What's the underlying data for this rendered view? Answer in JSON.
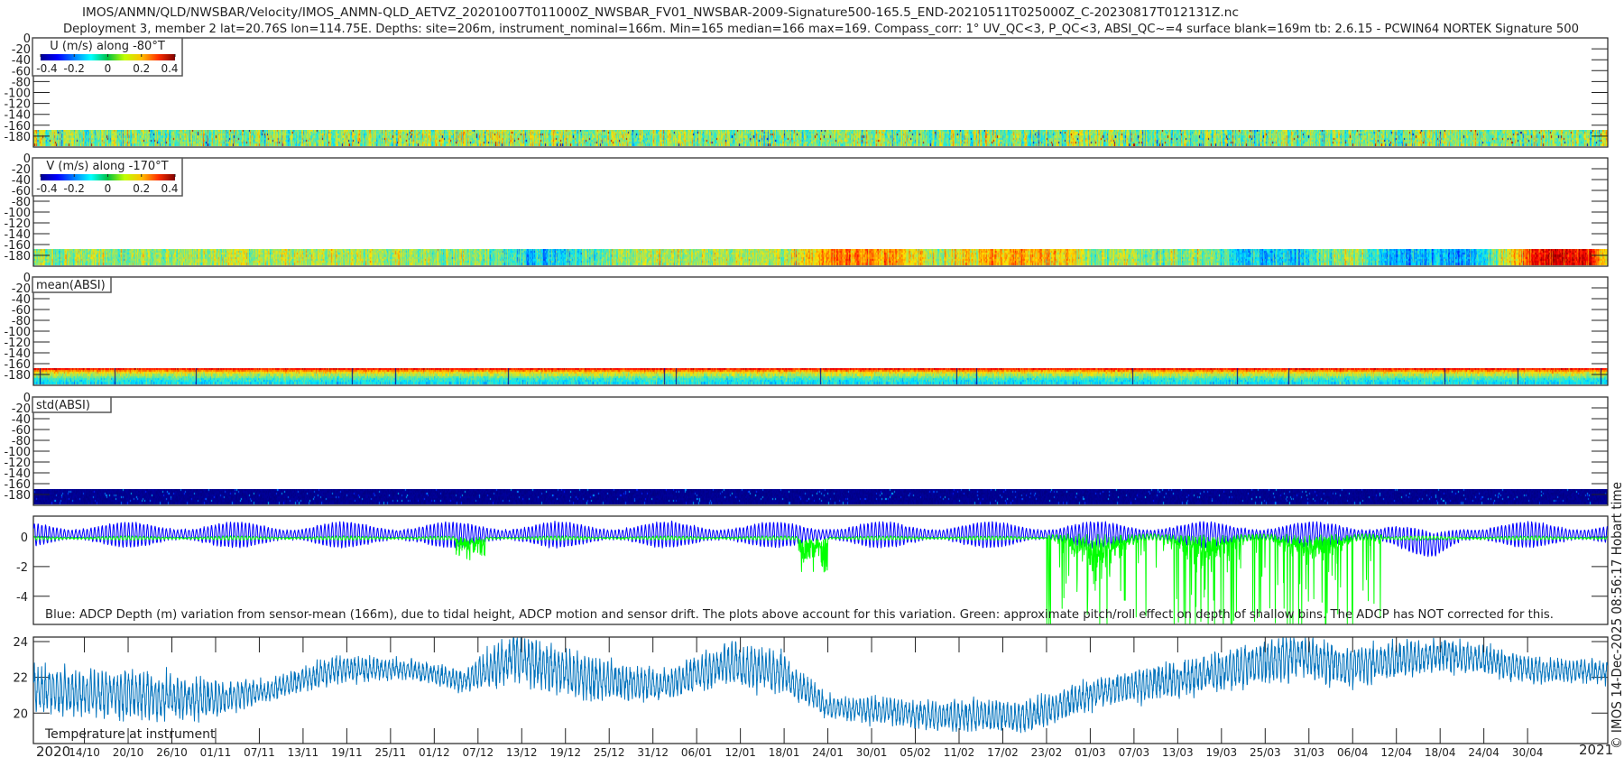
{
  "title": {
    "line1": "IMOS/ANMN/QLD/NWSBAR/Velocity/IMOS_ANMN-QLD_AETVZ_20201007T011000Z_NWSBAR_FV01_NWSBAR-2009-Signature500-165.5_END-20210511T025000Z_C-20230817T012131Z.nc",
    "line2": "Deployment 3, member 2 lat=20.76S lon=114.75E. Depths: site=206m, instrument_nominal=166m. Min=165 median=166 max=169. Compass_corr: 1° UV_QC<3, P_QC<3, ABSI_QC~=4 surface blank=169m tb: 2.6.15 - PCWIN64 NORTEK Signature 500"
  },
  "credit": "© IMOS 14-Dec-2025 08:56:17 Hobart time",
  "x_axis": {
    "units": "days since 2020-10-07",
    "range_days": [
      0,
      216
    ],
    "start_year": "2020",
    "end_year": "2021",
    "first_tick_day": 7,
    "tick_spacing_days": 6,
    "tick_labels": [
      "14/10",
      "20/10",
      "26/10",
      "01/11",
      "07/11",
      "13/11",
      "19/11",
      "25/11",
      "01/12",
      "07/12",
      "13/12",
      "19/12",
      "25/12",
      "31/12",
      "06/01",
      "12/01",
      "18/01",
      "24/01",
      "30/01",
      "05/02",
      "11/02",
      "17/02",
      "23/02",
      "01/03",
      "07/03",
      "13/03",
      "19/03",
      "25/03",
      "31/03",
      "06/04",
      "12/04",
      "18/04",
      "24/04",
      "30/04"
    ]
  },
  "chart_data": [
    {
      "type": "heatmap",
      "id": "u",
      "legend_title": "U (m/s) along -80°T",
      "colorbar_ticks": [
        "-0.4",
        "-0.2",
        "0",
        "0.2",
        "0.4"
      ],
      "clim": [
        -0.4,
        0.4
      ],
      "colormap": "jet",
      "ylim": [
        -200,
        0
      ],
      "y_ticks": [
        "0",
        "-20",
        "-40",
        "-60",
        "-80",
        "-100",
        "-120",
        "-140",
        "-160",
        "-180"
      ],
      "data_depth_range": [
        -198,
        -168
      ],
      "trend": [
        [
          0,
          0.0
        ],
        [
          60,
          0.02
        ],
        [
          110,
          0.0
        ],
        [
          216,
          0.0
        ]
      ],
      "noise": 0.13
    },
    {
      "type": "heatmap",
      "id": "v",
      "legend_title": "V (m/s) along -170°T",
      "colorbar_ticks": [
        "-0.4",
        "-0.2",
        "0",
        "0.2",
        "0.4"
      ],
      "clim": [
        -0.4,
        0.4
      ],
      "colormap": "jet",
      "ylim": [
        -200,
        0
      ],
      "y_ticks": [
        "0",
        "-20",
        "-40",
        "-60",
        "-80",
        "-100",
        "-120",
        "-140",
        "-160",
        "-180"
      ],
      "data_depth_range": [
        -198,
        -168
      ],
      "trend": [
        [
          0,
          0.0
        ],
        [
          40,
          0.05
        ],
        [
          62,
          0.0
        ],
        [
          68,
          -0.12
        ],
        [
          74,
          -0.08
        ],
        [
          80,
          0.02
        ],
        [
          104,
          0.05
        ],
        [
          110,
          0.2
        ],
        [
          118,
          0.15
        ],
        [
          124,
          0.05
        ],
        [
          132,
          0.16
        ],
        [
          140,
          0.14
        ],
        [
          146,
          0.02
        ],
        [
          160,
          0.0
        ],
        [
          166,
          -0.12
        ],
        [
          174,
          -0.1
        ],
        [
          180,
          0.05
        ],
        [
          186,
          -0.15
        ],
        [
          198,
          -0.12
        ],
        [
          203,
          0.1
        ],
        [
          206,
          0.3
        ],
        [
          213,
          0.32
        ],
        [
          216,
          0.1
        ]
      ],
      "noise": 0.1
    },
    {
      "type": "heatmap",
      "id": "mean_absi",
      "legend_title": "mean(ABSI)",
      "ylim": [
        -200,
        0
      ],
      "y_ticks": [
        "0",
        "-20",
        "-40",
        "-60",
        "-80",
        "-100",
        "-120",
        "-140",
        "-160",
        "-180"
      ],
      "data_depth_range": [
        -198,
        -168
      ],
      "profile_normalized": [
        0.85,
        0.72,
        0.62,
        0.55,
        0.48,
        0.43,
        0.4,
        0.38
      ]
    },
    {
      "type": "heatmap",
      "id": "std_absi",
      "legend_title": "std(ABSI)",
      "ylim": [
        -200,
        0
      ],
      "y_ticks": [
        "0",
        "-20",
        "-40",
        "-60",
        "-80",
        "-100",
        "-120",
        "-140",
        "-160",
        "-180"
      ],
      "data_depth_range": [
        -198,
        -170
      ],
      "level_normalized": 0.05
    },
    {
      "type": "line",
      "id": "depth",
      "annotation": "Blue: ADCP Depth (m) variation from sensor-mean (166m), due to tidal height, ADCP motion and sensor drift. The plots above account for this variation. Green: approximate pitch/roll effect on depth of shallow bins. The ADCP has NOT corrected for this.",
      "ylim": [
        -5.9,
        1.4
      ],
      "y_ticks": [
        {
          "v": 0,
          "label": "0"
        },
        {
          "v": -2,
          "label": "-2"
        },
        {
          "v": -4,
          "label": "-4"
        }
      ],
      "series": [
        {
          "name": "ADCP depth variation",
          "color": "#0000ff",
          "offset": 0.15,
          "tidal_amp_range": [
            0.3,
            0.85
          ],
          "dip": [
            [
              186,
              0
            ],
            [
              192,
              -0.7
            ],
            [
              196,
              0
            ]
          ]
        },
        {
          "name": "pitch/roll effect",
          "color": "#00ff00",
          "events": [
            [
              58,
              62,
              -1.3
            ],
            [
              105,
              109,
              -2.2
            ],
            [
              139,
              185,
              -7
            ]
          ]
        }
      ]
    },
    {
      "type": "line",
      "id": "temperature",
      "annotation": "Temperature at instrument",
      "ylim": [
        18.3,
        24.25
      ],
      "y_ticks": [
        {
          "v": 20,
          "label": "20"
        },
        {
          "v": 22,
          "label": "22"
        },
        {
          "v": 24,
          "label": "24"
        }
      ],
      "color": "#0072bd",
      "trend_day_mean_halfrange": [
        [
          1,
          21.3,
          1.2
        ],
        [
          14,
          21.0,
          1.3
        ],
        [
          24,
          20.8,
          1.0
        ],
        [
          32,
          21.2,
          0.6
        ],
        [
          42,
          22.5,
          0.7
        ],
        [
          52,
          22.4,
          0.5
        ],
        [
          59,
          21.8,
          0.6
        ],
        [
          66,
          23.2,
          1.4
        ],
        [
          75,
          22.0,
          1.3
        ],
        [
          86,
          21.5,
          0.8
        ],
        [
          95,
          22.8,
          1.2
        ],
        [
          103,
          22.2,
          1.0
        ],
        [
          109,
          20.3,
          0.6
        ],
        [
          123,
          19.9,
          0.8
        ],
        [
          137,
          19.8,
          0.9
        ],
        [
          146,
          21.2,
          0.8
        ],
        [
          159,
          22.0,
          1.0
        ],
        [
          173,
          23.2,
          1.2
        ],
        [
          180,
          22.6,
          1.1
        ],
        [
          194,
          23.3,
          0.9
        ],
        [
          206,
          22.4,
          0.7
        ],
        [
          216,
          22.3,
          0.6
        ]
      ]
    }
  ]
}
